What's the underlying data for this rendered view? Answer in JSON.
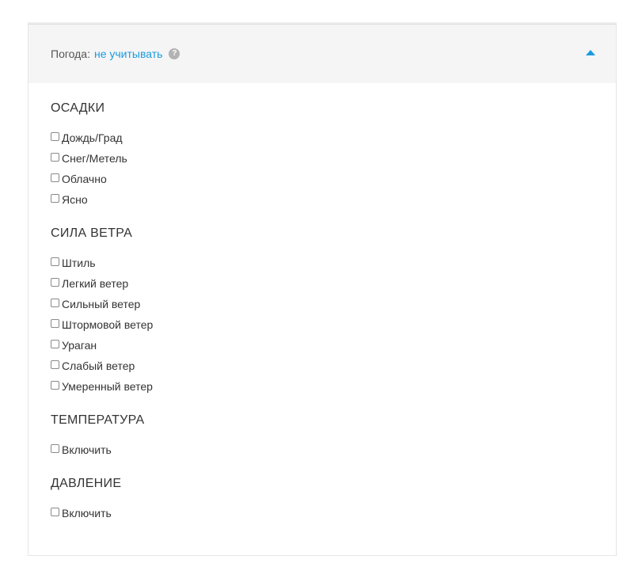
{
  "header": {
    "label": "Погода:",
    "value": "не учитывать",
    "help_glyph": "?",
    "help_icon": "question-circle-icon",
    "toggle_icon": "caret-up-icon",
    "accent_color": "#1a9be0"
  },
  "sections": [
    {
      "title": "ОСАДКИ",
      "options": [
        {
          "label": "Дождь/Град",
          "checked": false
        },
        {
          "label": "Снег/Метель",
          "checked": false
        },
        {
          "label": "Облачно",
          "checked": false
        },
        {
          "label": "Ясно",
          "checked": false
        }
      ]
    },
    {
      "title": "СИЛА ВЕТРА",
      "options": [
        {
          "label": "Штиль",
          "checked": false
        },
        {
          "label": "Легкий ветер",
          "checked": false
        },
        {
          "label": "Сильный ветер",
          "checked": false
        },
        {
          "label": "Штормовой ветер",
          "checked": false
        },
        {
          "label": "Ураган",
          "checked": false
        },
        {
          "label": "Слабый ветер",
          "checked": false
        },
        {
          "label": "Умеренный ветер",
          "checked": false
        }
      ]
    },
    {
      "title": "ТЕМПЕРАТУРА",
      "options": [
        {
          "label": "Включить",
          "checked": false
        }
      ]
    },
    {
      "title": "ДАВЛЕНИЕ",
      "options": [
        {
          "label": "Включить",
          "checked": false
        }
      ]
    }
  ]
}
